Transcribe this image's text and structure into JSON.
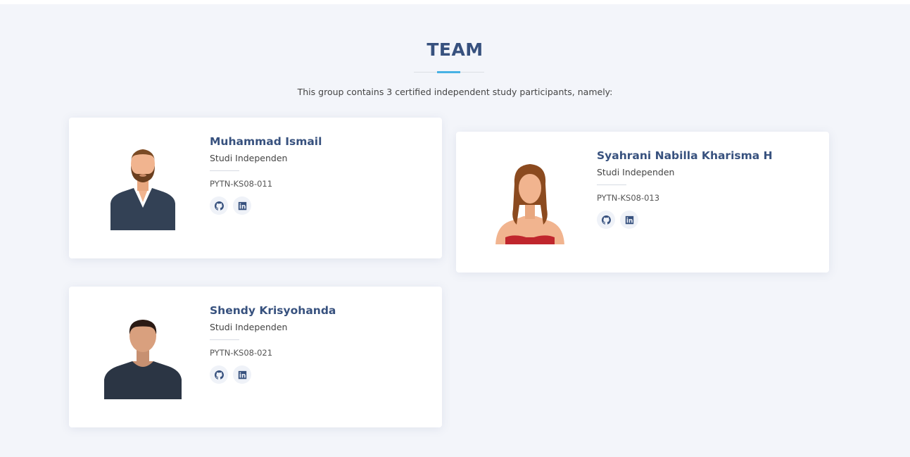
{
  "section": {
    "title": "TEAM",
    "subtitle": "This group contains 3 certified independent study participants, namely:"
  },
  "team": [
    {
      "name": "Muhammad Ismail",
      "role": "Studi Independen",
      "code": "PYTN-KS08-011",
      "avatar_icon": "man-with-beard-avatar-icon",
      "social": [
        "github-icon",
        "linkedin-icon"
      ]
    },
    {
      "name": "Syahrani Nabilla Kharisma H",
      "role": "Studi Independen",
      "code": "PYTN-KS08-013",
      "avatar_icon": "woman-avatar-icon",
      "social": [
        "github-icon",
        "linkedin-icon"
      ]
    },
    {
      "name": "Shendy Krisyohanda",
      "role": "Studi Independen",
      "code": "PYTN-KS08-021",
      "avatar_icon": "man-avatar-icon",
      "social": [
        "github-icon",
        "linkedin-icon"
      ]
    }
  ],
  "colors": {
    "heading": "#37517e",
    "accent": "#47b2e4",
    "background": "#f3f5fa",
    "card": "#ffffff"
  }
}
